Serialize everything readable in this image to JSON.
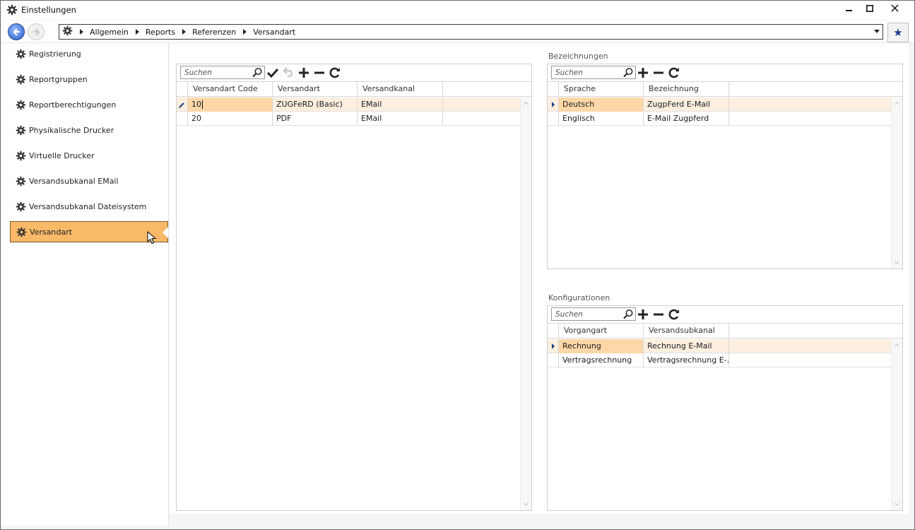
{
  "window": {
    "title": "Einstellungen",
    "icons": {
      "title": "gear-icon",
      "minimize": "minimize-icon",
      "maximize": "maximize-icon",
      "close": "close-icon"
    }
  },
  "nav": {
    "breadcrumbs": [
      "Allgemein",
      "Reports",
      "Referenzen",
      "Versandart"
    ],
    "favorite_icon": "star-icon"
  },
  "sidebar": {
    "items": [
      {
        "label": "Registrierung",
        "active": false
      },
      {
        "label": "Reportgruppen",
        "active": false
      },
      {
        "label": "Reportberechtigungen",
        "active": false
      },
      {
        "label": "Physikalische Drucker",
        "active": false
      },
      {
        "label": "Virtuelle Drucker",
        "active": false
      },
      {
        "label": "Versandsubkanal EMail",
        "active": false
      },
      {
        "label": "Versandsubkanal Dateisystem",
        "active": false
      },
      {
        "label": "Versandart",
        "active": true
      }
    ],
    "accent_color": "#f9b968"
  },
  "main_grid": {
    "search_placeholder": "Suchen",
    "columns": [
      "Versandart Code",
      "Versandart",
      "Versandkanal"
    ],
    "rows": [
      {
        "cells": [
          "10",
          "ZUGFeRD (Basic)",
          "EMail"
        ],
        "selected": true,
        "editing": true
      },
      {
        "cells": [
          "20",
          "PDF",
          "EMail"
        ],
        "selected": false,
        "editing": false
      }
    ]
  },
  "bezeichnungen": {
    "title": "Bezeichnungen",
    "search_placeholder": "Suchen",
    "columns": [
      "Sprache",
      "Bezeichnung"
    ],
    "rows": [
      {
        "cells": [
          "Deutsch",
          "ZugpFerd E-Mail"
        ],
        "selected": true
      },
      {
        "cells": [
          "Englisch",
          "E-Mail Zugpferd"
        ],
        "selected": false
      }
    ]
  },
  "konfigurationen": {
    "title": "Konfigurationen",
    "search_placeholder": "Suchen",
    "columns": [
      "Vorgangart",
      "Versandsubkanal"
    ],
    "rows": [
      {
        "cells": [
          "Rechnung",
          "Rechnung E-Mail"
        ],
        "selected": true
      },
      {
        "cells": [
          "Vertragsrechnung",
          "Vertragsrechnung E-…"
        ],
        "selected": false
      }
    ]
  }
}
